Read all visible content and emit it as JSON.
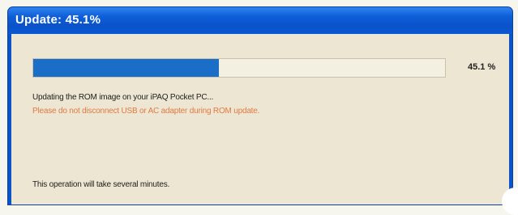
{
  "window": {
    "title": "Update: 45.1%"
  },
  "progress": {
    "value_percent": 45.1,
    "percent_label": "45.1  %",
    "fill_color": "#1b6ec8"
  },
  "messages": {
    "status": "Updating the ROM image on your iPAQ Pocket PC...",
    "warning": "Please do not disconnect USB or AC adapter during ROM update.",
    "note": "This operation will take several minutes."
  },
  "colors": {
    "titlebar": "#0a53c9",
    "client": "#ece6d2",
    "warning": "#e07a45"
  }
}
